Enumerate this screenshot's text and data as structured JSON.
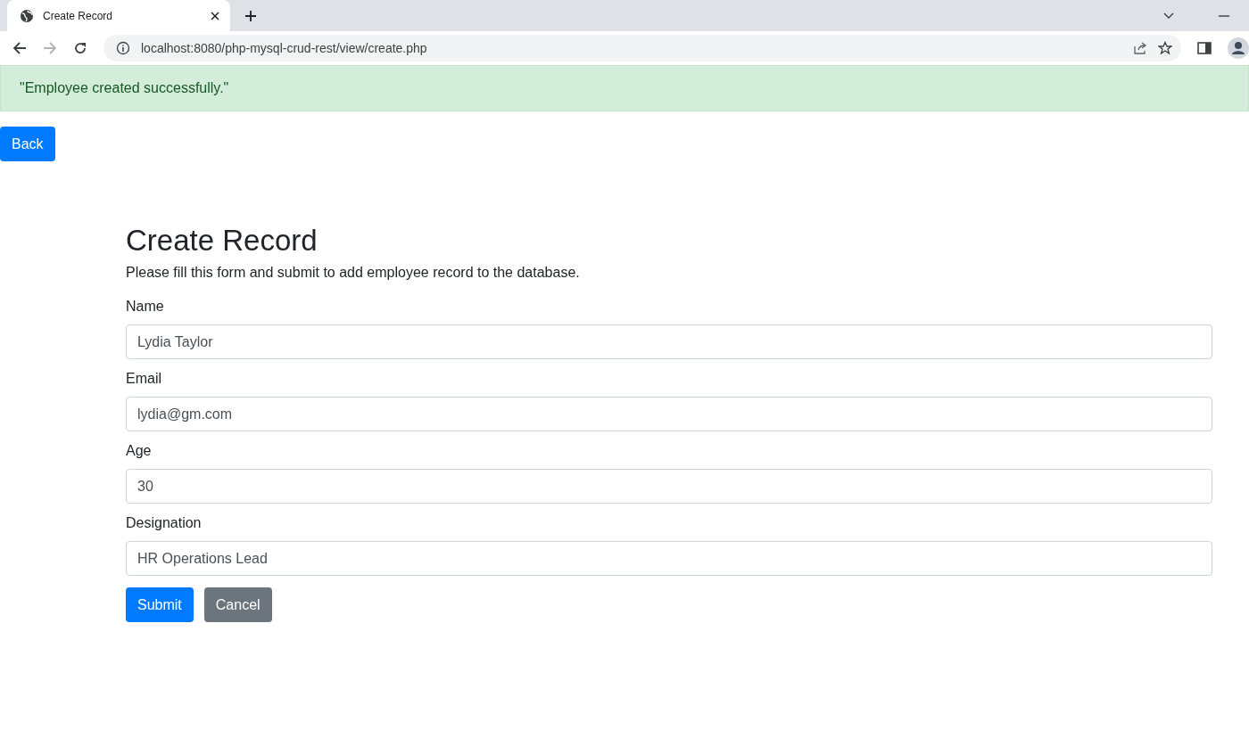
{
  "browser": {
    "tabs": [
      {
        "title": "Create Record",
        "selected": true
      }
    ],
    "nav": {
      "back_disabled": false,
      "forward_disabled": true
    },
    "url": "localhost:8080/php-mysql-crud-rest/view/create.php"
  },
  "alert": {
    "text": "\"Employee created successfully.\""
  },
  "back_button": "Back",
  "form": {
    "title": "Create Record",
    "description": "Please fill this form and submit to add employee record to the database.",
    "fields": [
      {
        "label": "Name",
        "value": "Lydia Taylor"
      },
      {
        "label": "Email",
        "value": "lydia@gm.com"
      },
      {
        "label": "Age",
        "value": "30"
      },
      {
        "label": "Designation",
        "value": "HR Operations Lead"
      }
    ],
    "buttons": [
      {
        "label": "Submit",
        "kind": "primary"
      },
      {
        "label": "Cancel",
        "kind": "secondary"
      }
    ]
  }
}
